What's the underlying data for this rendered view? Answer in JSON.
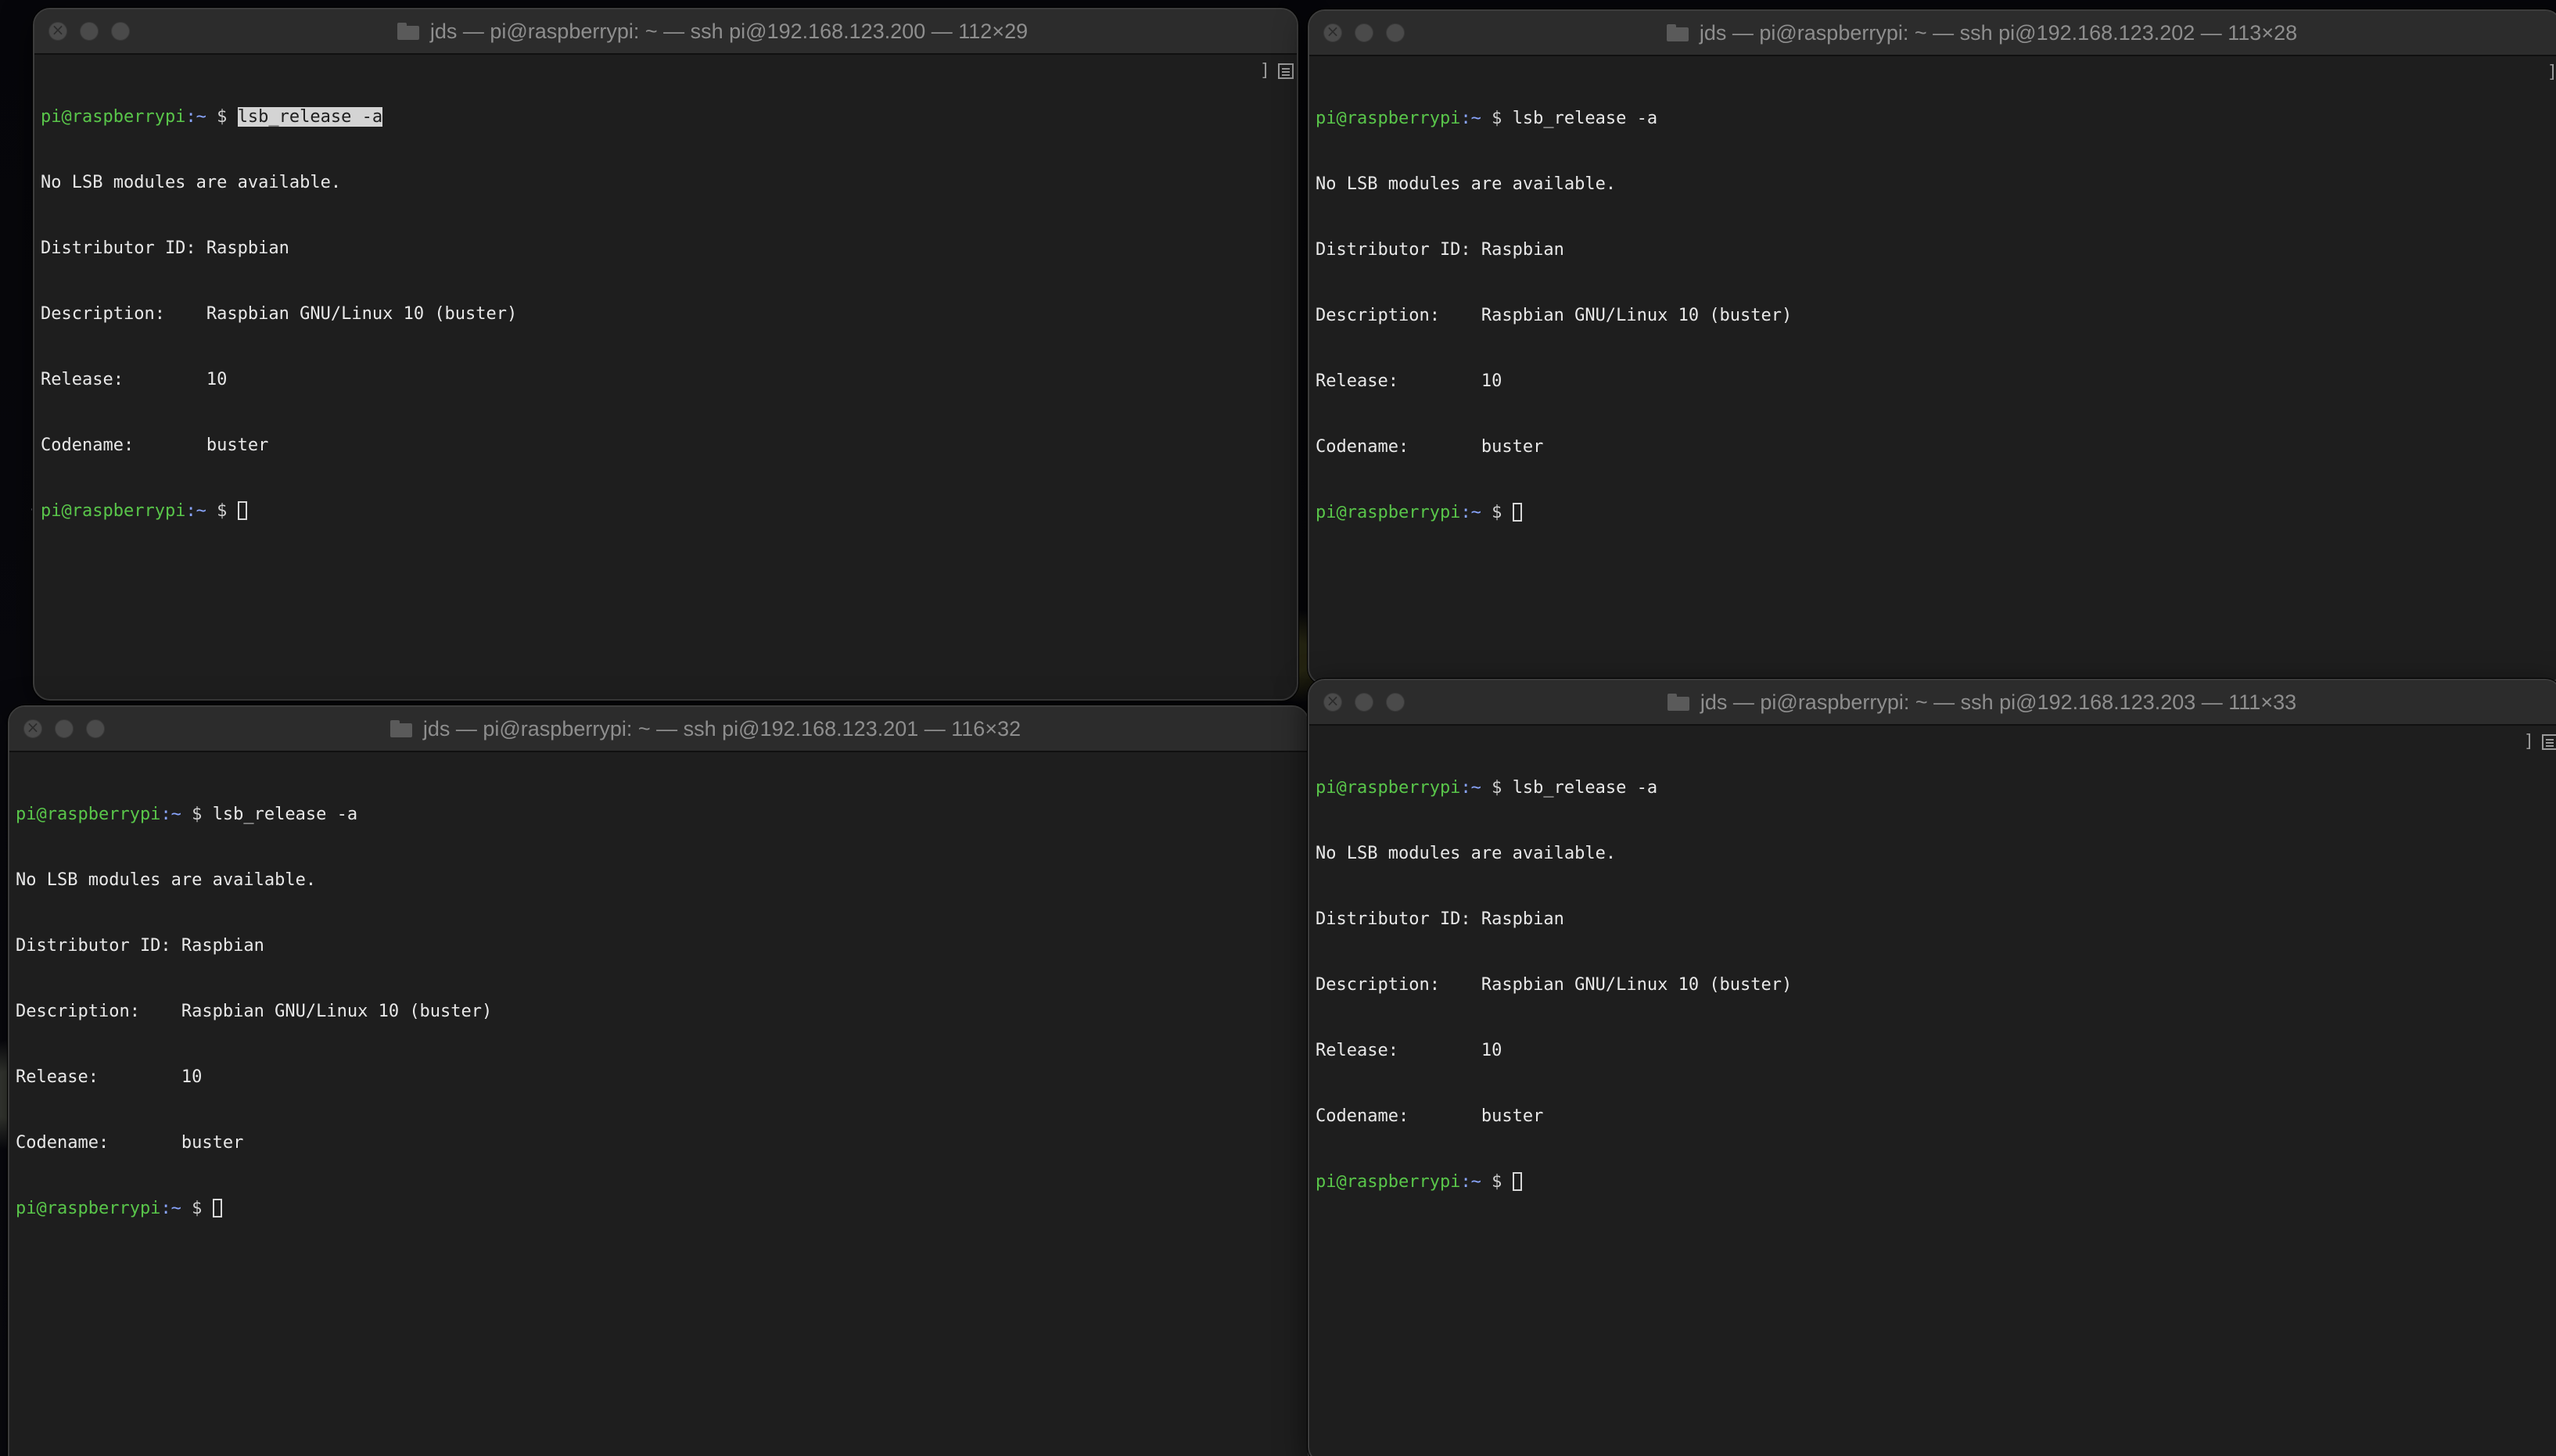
{
  "windows": [
    {
      "id": "tl",
      "title": "jds — pi@raspberrypi: ~ — ssh pi@192.168.123.200 — 112×29",
      "prompt_user": "pi@raspberrypi",
      "prompt_path": ":~",
      "prompt_symbol": " $ ",
      "command": "lsb_release -a",
      "command_selected": true,
      "output": [
        "No LSB modules are available.",
        "Distributor ID: Raspbian",
        "Description:    Raspbian GNU/Linux 10 (buster)",
        "Release:        10",
        "Codename:       buster"
      ]
    },
    {
      "id": "tr",
      "title": "jds — pi@raspberrypi: ~ — ssh pi@192.168.123.202 — 113×28",
      "prompt_user": "pi@raspberrypi",
      "prompt_path": ":~",
      "prompt_symbol": " $ ",
      "command": "lsb_release -a",
      "command_selected": false,
      "output": [
        "No LSB modules are available.",
        "Distributor ID: Raspbian",
        "Description:    Raspbian GNU/Linux 10 (buster)",
        "Release:        10",
        "Codename:       buster"
      ]
    },
    {
      "id": "bl",
      "title": "jds — pi@raspberrypi: ~ — ssh pi@192.168.123.201 — 116×32",
      "prompt_user": "pi@raspberrypi",
      "prompt_path": ":~",
      "prompt_symbol": " $ ",
      "command": "lsb_release -a",
      "command_selected": false,
      "output": [
        "No LSB modules are available.",
        "Distributor ID: Raspbian",
        "Description:    Raspbian GNU/Linux 10 (buster)",
        "Release:        10",
        "Codename:       buster"
      ]
    },
    {
      "id": "br",
      "title": "jds — pi@raspberrypi: ~ — ssh pi@192.168.123.203 — 111×33",
      "prompt_user": "pi@raspberrypi",
      "prompt_path": ":~",
      "prompt_symbol": " $ ",
      "command": "lsb_release -a",
      "command_selected": false,
      "output": [
        "No LSB modules are available.",
        "Distributor ID: Raspbian",
        "Description:    Raspbian GNU/Linux 10 (buster)",
        "Release:        10",
        "Codename:       buster"
      ]
    }
  ],
  "colors": {
    "terminal_bg": "#1e1e1e",
    "prompt_user": "#59c64a",
    "prompt_path": "#8aa6ff",
    "text": "#e8e8e8",
    "titlebar": "#2c2c2c",
    "title_text": "#8e8e8e"
  },
  "icons": {
    "titlebar_icon": "folder-icon",
    "scroll_menu": "menu-icon",
    "window_controls": [
      "close-icon",
      "minimize-icon",
      "zoom-icon"
    ]
  }
}
